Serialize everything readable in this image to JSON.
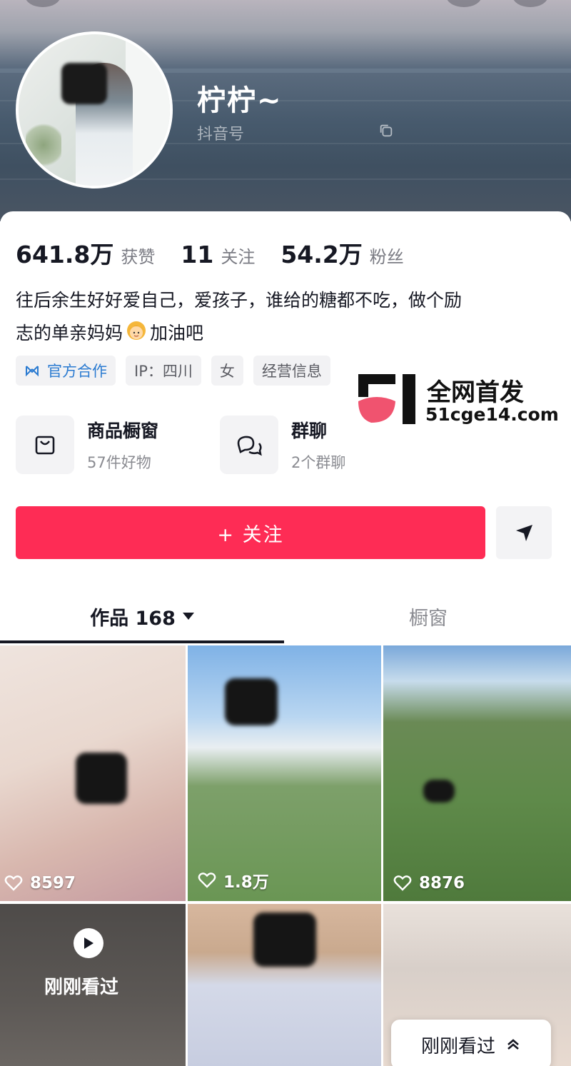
{
  "profile": {
    "nickname": "柠柠~",
    "douyin_id_label": "抖音号",
    "avatar_alt": "avatar",
    "stats": [
      {
        "value": "641.8万",
        "label": "获赞"
      },
      {
        "value": "11",
        "label": "关注"
      },
      {
        "value": "54.2万",
        "label": "粉丝"
      }
    ],
    "bio_line1": "往后余生好好爱自己，爱孩子，谁给的糖都不吃，做个励",
    "bio_line2_before": "志的单亲妈妈",
    "bio_line2_after": "加油吧",
    "tags": {
      "official": "官方合作",
      "ip": "IP：四川",
      "gender": "女",
      "business": "经营信息"
    }
  },
  "watermark": {
    "title": "全网首发",
    "url": "51cge14.com"
  },
  "services": [
    {
      "title": "商品橱窗",
      "sub": "57件好物"
    },
    {
      "title": "群聊",
      "sub": "2个群聊"
    }
  ],
  "actions": {
    "follow_label": "+ 关注"
  },
  "tabs": {
    "works": "作品 168",
    "showcase": "橱窗"
  },
  "videos": [
    {
      "likes": "8597"
    },
    {
      "likes": "1.8万"
    },
    {
      "likes": "8876"
    }
  ],
  "recently_viewed": {
    "overlay_text": "刚刚看过",
    "pill_text": "刚刚看过"
  },
  "colors": {
    "follow_button": "#fe2c55",
    "official_tag_text": "#2b7bd1",
    "text_primary": "#161823",
    "text_secondary": "#8a8b91"
  },
  "icons": {
    "copy": "copy-icon",
    "cart": "shopping-bag-icon",
    "group_chat": "chat-bubbles-icon",
    "send": "paper-plane-icon",
    "heart": "heart-outline-icon",
    "play": "play-icon",
    "chevron": "chevron-up-icon"
  }
}
